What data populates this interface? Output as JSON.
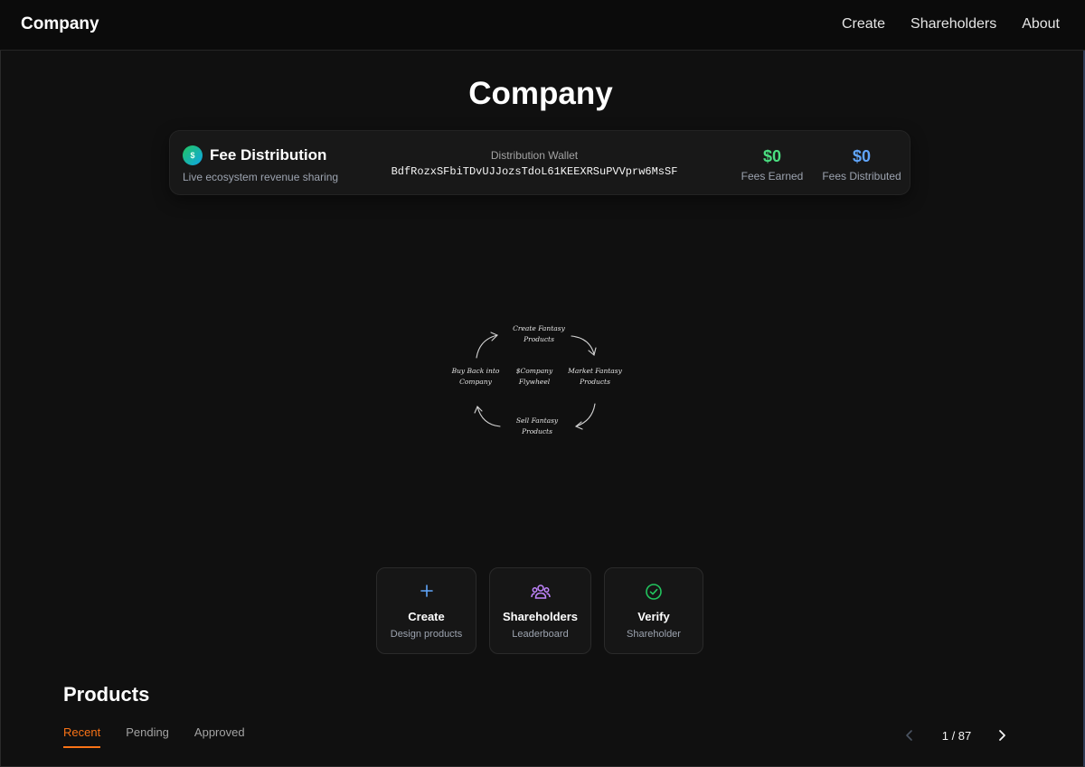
{
  "header": {
    "brand": "Company",
    "nav": [
      {
        "label": "Create"
      },
      {
        "label": "Shareholders"
      },
      {
        "label": "About"
      }
    ]
  },
  "page_title": "Company",
  "fee_card": {
    "icon_glyph": "$",
    "title": "Fee Distribution",
    "subtitle": "Live ecosystem revenue sharing",
    "wallet_label": "Distribution Wallet",
    "wallet_address": "BdfRozxSFbiTDvUJJozsTdoL61KEEXRSuPVVprw6MsSF",
    "fees_earned_value": "$0",
    "fees_earned_label": "Fees Earned",
    "fees_distributed_value": "$0",
    "fees_distributed_label": "Fees Distributed",
    "colors": {
      "earned": "#4ade80",
      "distributed": "#60a5fa"
    }
  },
  "flywheel": {
    "center_line1": "$Company",
    "center_line2": "Flywheel",
    "top_line1": "Create Fantasy",
    "top_line2": "Products",
    "right_line1": "Market Fantasy",
    "right_line2": "Products",
    "bottom_line1": "Sell Fantasy",
    "bottom_line2": "Products",
    "left_line1": "Buy Back into",
    "left_line2": "Company"
  },
  "actions": [
    {
      "title": "Create",
      "subtitle": "Design products",
      "icon": "plus-icon",
      "color": "#60a5fa"
    },
    {
      "title": "Shareholders",
      "subtitle": "Leaderboard",
      "icon": "users-icon",
      "color": "#c084fc"
    },
    {
      "title": "Verify",
      "subtitle": "Shareholder",
      "icon": "check-circle-icon",
      "color": "#22c55e"
    }
  ],
  "products": {
    "title": "Products",
    "tabs": [
      {
        "label": "Recent",
        "active": true
      },
      {
        "label": "Pending",
        "active": false
      },
      {
        "label": "Approved",
        "active": false
      }
    ],
    "pager_text": "1 / 87",
    "accent": "#f97316"
  }
}
